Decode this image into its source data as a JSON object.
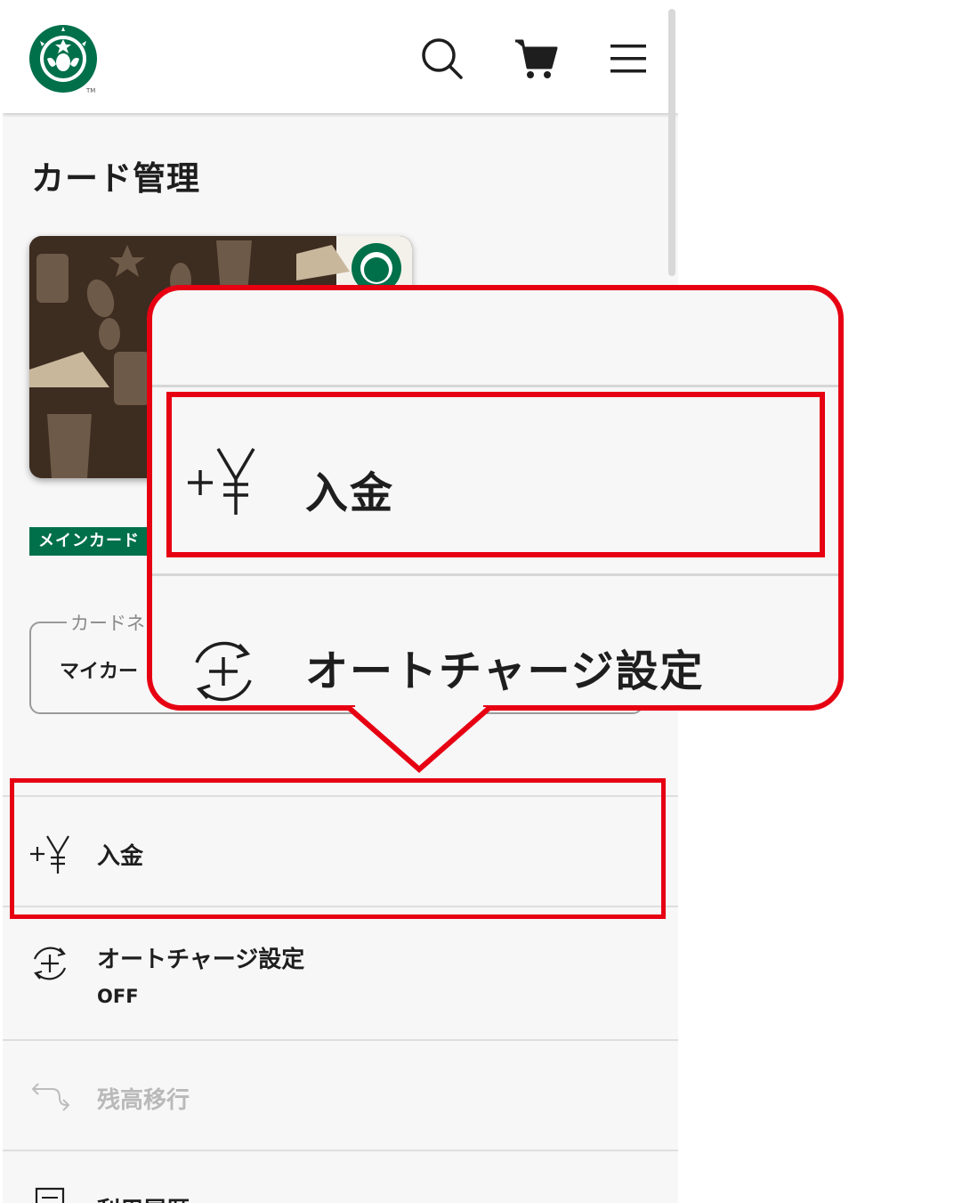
{
  "header": {
    "logo": "starbucks-siren-logo",
    "trademark": "TM",
    "icons": [
      "search-icon",
      "cart-icon",
      "hamburger-menu-icon"
    ]
  },
  "page": {
    "title": "カード管理"
  },
  "card": {
    "badge": "メインカード"
  },
  "nickname": {
    "label": "カードネ",
    "value": "マイカー"
  },
  "menu": {
    "items": [
      {
        "label": "入金",
        "icon": "yen-plus-icon"
      },
      {
        "label": "オートチャージ設定",
        "sub": "OFF",
        "icon": "auto-charge-icon"
      },
      {
        "label": "残高移行",
        "icon": "transfer-arrows-icon",
        "disabled": true
      },
      {
        "label": "利用履歴",
        "icon": "receipt-icon"
      }
    ]
  },
  "callout": {
    "items": [
      {
        "label": "入金",
        "icon": "yen-plus-icon"
      },
      {
        "label": "オートチャージ設定",
        "icon": "auto-charge-icon"
      }
    ]
  },
  "colors": {
    "brand_green": "#00704a",
    "highlight_red": "#e60012",
    "background": "#f7f7f7"
  }
}
